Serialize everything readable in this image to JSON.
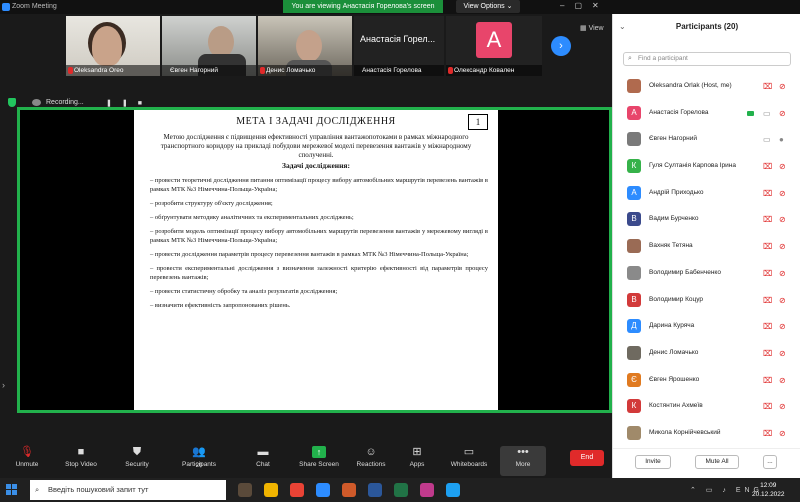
{
  "window": {
    "title": "Zoom Meeting",
    "banner": "You are viewing Анастасія Горелова's screen",
    "view_options": "View Options ⌄"
  },
  "videos": {
    "tiles": [
      {
        "name": "Oleksandra Oreo"
      },
      {
        "name": "Євген Нагорний"
      },
      {
        "name": "Денис Ломачько"
      },
      {
        "name": "Анастасія Горелова",
        "display": "Анастасія Горел..."
      },
      {
        "name": "Олександр Ковален",
        "avatar": "A"
      }
    ],
    "view_label": "View"
  },
  "recording": {
    "label": "Recording..."
  },
  "document": {
    "heading": "МЕТА І ЗАДАЧІ ДОСЛІДЖЕННЯ",
    "page_number": "1",
    "purpose": "Метою дослідження є підвищення ефективності управління вантажопотоками в рамках міжнародного транспортного коридору на прикладі побудови мережевої моделі перевезення вантажів у міжнародному сполученні.",
    "tasks_title": "Задачі дослідження:",
    "tasks": [
      "– провести теоретичні дослідження питання оптимізації процесу вибору автомобільних маршрутів перевезень вантажів в рамках МТК №3 Німеччина-Польща-Україна;",
      "– розробити структуру об'єкту дослідження;",
      "– обґрунтувати методику аналітичних та експериментальних досліджень;",
      "– розробити модель оптимізації процесу вибору автомобільних маршрутів перевезення вантажів у мережевому вигляді в рамках МТК №3 Німеччина-Польща-Україна;",
      "– провести дослідження параметрів процесу перевезення вантажів в рамках МТК №3 Німеччина-Польща-Україна;",
      "– провести експериментальні дослідження з визначення залежності критерію ефективності від параметрів процесу перевезень вантажів;",
      "– провести статистичну обробку та аналіз результатів дослідження;",
      "– визначити ефективність запропонованих рішень."
    ]
  },
  "toolbar": {
    "unmute": "Unmute",
    "stop_video": "Stop Video",
    "security": "Security",
    "participants": "Participants",
    "participants_count": "20",
    "chat": "Chat",
    "share_screen": "Share Screen",
    "reactions": "Reactions",
    "apps": "Apps",
    "whiteboards": "Whiteboards",
    "more": "More",
    "end": "End"
  },
  "participants_panel": {
    "title": "Participants (20)",
    "search_placeholder": "Find a participant",
    "invite": "Invite",
    "mute_all": "Mute All",
    "more": "...",
    "list": [
      {
        "name": "Oleksandra Orlak (Host, me)",
        "initial": "",
        "color": "#b06a4e",
        "video_off": true,
        "muted": true
      },
      {
        "name": "Анастасія Горелова",
        "initial": "А",
        "color": "#e8456b",
        "video_off": false,
        "muted": true,
        "sharing": true
      },
      {
        "name": "Євген Нагорний",
        "initial": "",
        "color": "#7a7a7a",
        "video_off": false,
        "muted": false
      },
      {
        "name": "Гуля Султанія Карпова Ірина",
        "initial": "К",
        "color": "#36b24a",
        "video_off": true,
        "muted": true
      },
      {
        "name": "Андрій Приходько",
        "initial": "А",
        "color": "#2d8cff",
        "video_off": true,
        "muted": true
      },
      {
        "name": "Вадим Бурченко",
        "initial": "В",
        "color": "#3b4a8c",
        "video_off": true,
        "muted": true
      },
      {
        "name": "Вахняк Тетяна",
        "initial": "",
        "color": "#9a6b55",
        "video_off": true,
        "muted": true
      },
      {
        "name": "Володимир Бабенченко",
        "initial": "",
        "color": "#8a8a8a",
        "video_off": true,
        "muted": true
      },
      {
        "name": "Володимир Коцур",
        "initial": "В",
        "color": "#d23a3a",
        "video_off": true,
        "muted": true
      },
      {
        "name": "Дарина Куряча",
        "initial": "Д",
        "color": "#2d8cff",
        "video_off": true,
        "muted": true
      },
      {
        "name": "Денис Ломачько",
        "initial": "",
        "color": "#6f6a60",
        "video_off": true,
        "muted": true
      },
      {
        "name": "Євген Ярошенко",
        "initial": "Є",
        "color": "#e07a20",
        "video_off": true,
        "muted": true
      },
      {
        "name": "Костянтин Ахмеїв",
        "initial": "К",
        "color": "#d23a3a",
        "video_off": true,
        "muted": true
      },
      {
        "name": "Микола Корнійчевський",
        "initial": "",
        "color": "#a08a6a",
        "video_off": true,
        "muted": true
      }
    ]
  },
  "taskbar": {
    "search_placeholder": "Введіть пошуковий запит тут",
    "time": "12:09",
    "date": "20.12.2022",
    "icon_colors": [
      "#5a4a3a",
      "#f0b400",
      "#ea4335",
      "#2d8cff",
      "#cf5a2a",
      "#2b579a",
      "#217346",
      "#c03a8c",
      "#1da0f2"
    ]
  }
}
